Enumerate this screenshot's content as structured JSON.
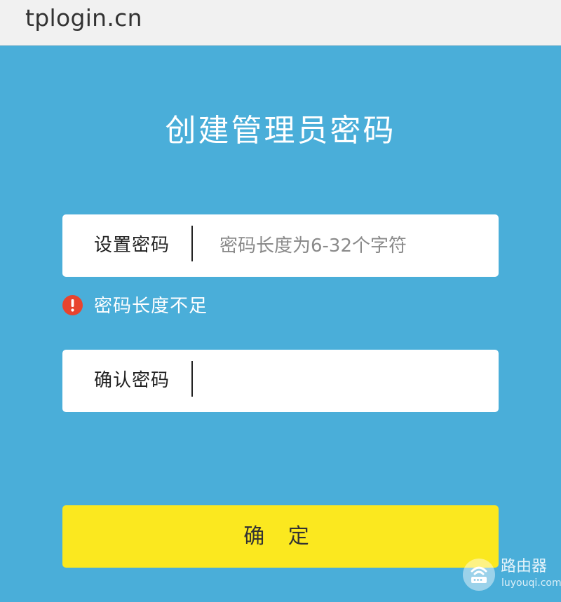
{
  "browser": {
    "address": "tplogin.cn"
  },
  "page": {
    "title": "创建管理员密码",
    "background_color": "#4aaed9"
  },
  "form": {
    "password": {
      "label": "设置密码",
      "value": "",
      "placeholder": "密码长度为6-32个字符"
    },
    "error": {
      "icon": "exclamation-icon",
      "icon_color": "#e8442f",
      "message": "密码长度不足"
    },
    "confirm": {
      "label": "确认密码",
      "value": "",
      "placeholder": ""
    },
    "submit": {
      "label": "确 定",
      "color": "#fbe81f"
    }
  },
  "watermark": {
    "icon": "router-logo-icon",
    "name": "路由器",
    "url": "luyouqi.com"
  }
}
